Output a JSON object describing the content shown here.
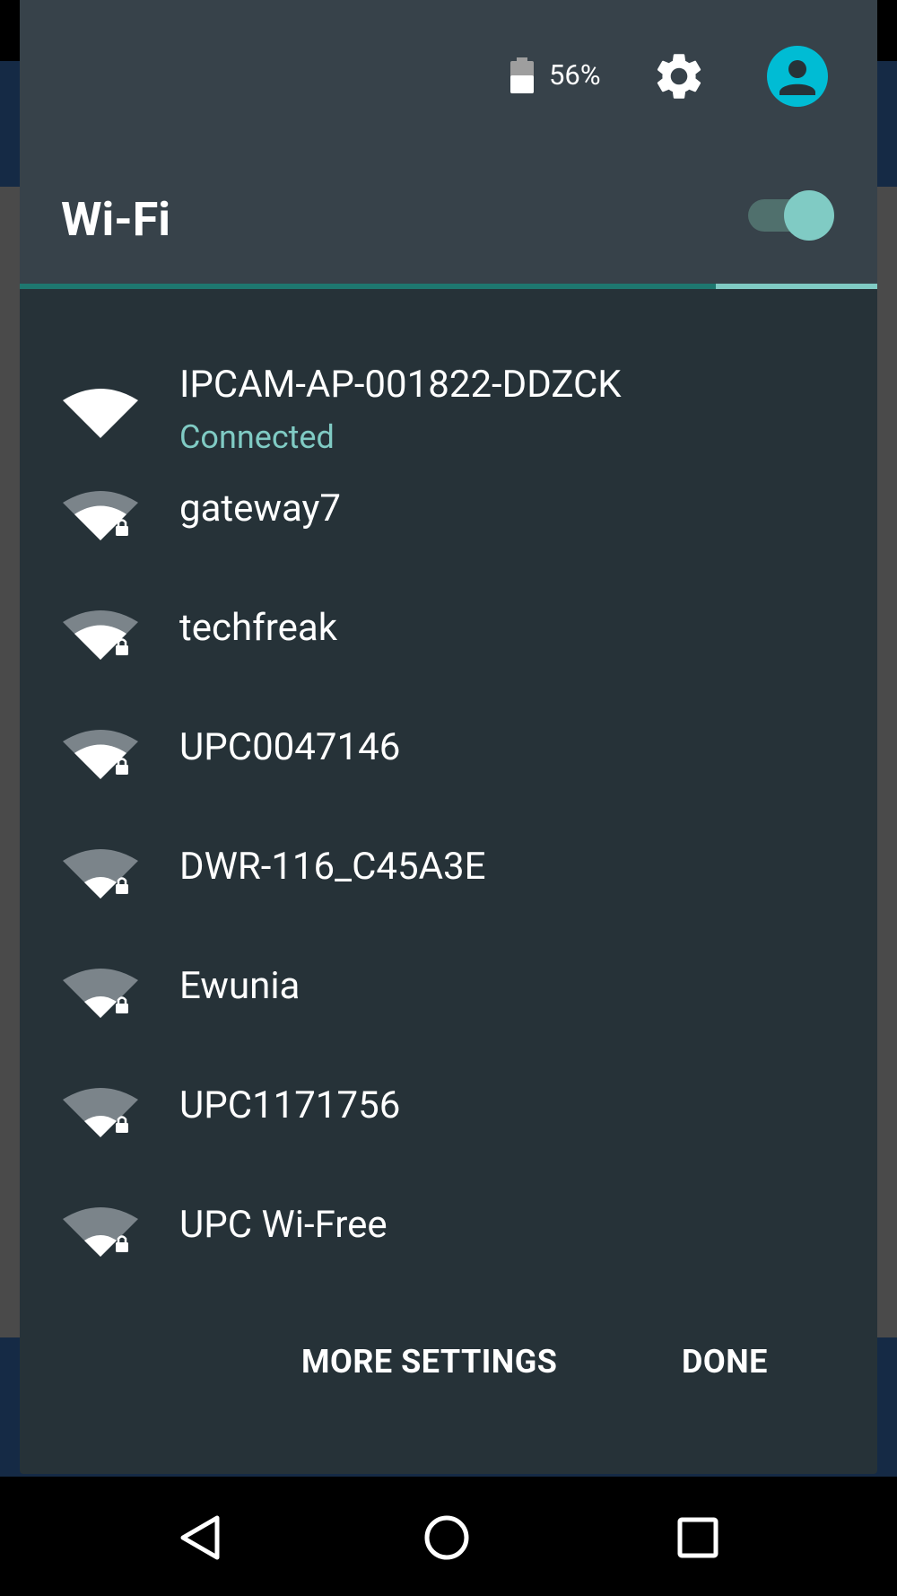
{
  "status": {
    "battery_percent": "56%",
    "battery_level": 0.56
  },
  "icons": {
    "battery": "battery-icon",
    "settings": "gear-icon",
    "account": "account-circle-icon",
    "wifi": "wifi-signal-icon",
    "lock": "lock-icon",
    "back": "back-icon",
    "home": "home-icon",
    "recents": "recents-icon"
  },
  "wifi": {
    "title": "Wi-Fi",
    "enabled": true
  },
  "networks": [
    {
      "name": "IPCAM-AP-001822-DDZCK",
      "status": "Connected",
      "secured": false,
      "signal": 4
    },
    {
      "name": "gateway7",
      "secured": true,
      "signal": 3
    },
    {
      "name": "techfreak",
      "secured": true,
      "signal": 3
    },
    {
      "name": "UPC0047146",
      "secured": true,
      "signal": 3
    },
    {
      "name": "DWR-116_C45A3E",
      "secured": true,
      "signal": 2
    },
    {
      "name": "Ewunia",
      "secured": true,
      "signal": 2
    },
    {
      "name": "UPC1171756",
      "secured": true,
      "signal": 2
    },
    {
      "name": "UPC Wi-Free",
      "secured": true,
      "signal": 2
    }
  ],
  "footer": {
    "more_settings_label": "MORE SETTINGS",
    "done_label": "DONE"
  },
  "colors": {
    "accent": "#80cbc4",
    "panel": "#263238",
    "header": "#37424a",
    "avatar": "#00bcd4"
  }
}
